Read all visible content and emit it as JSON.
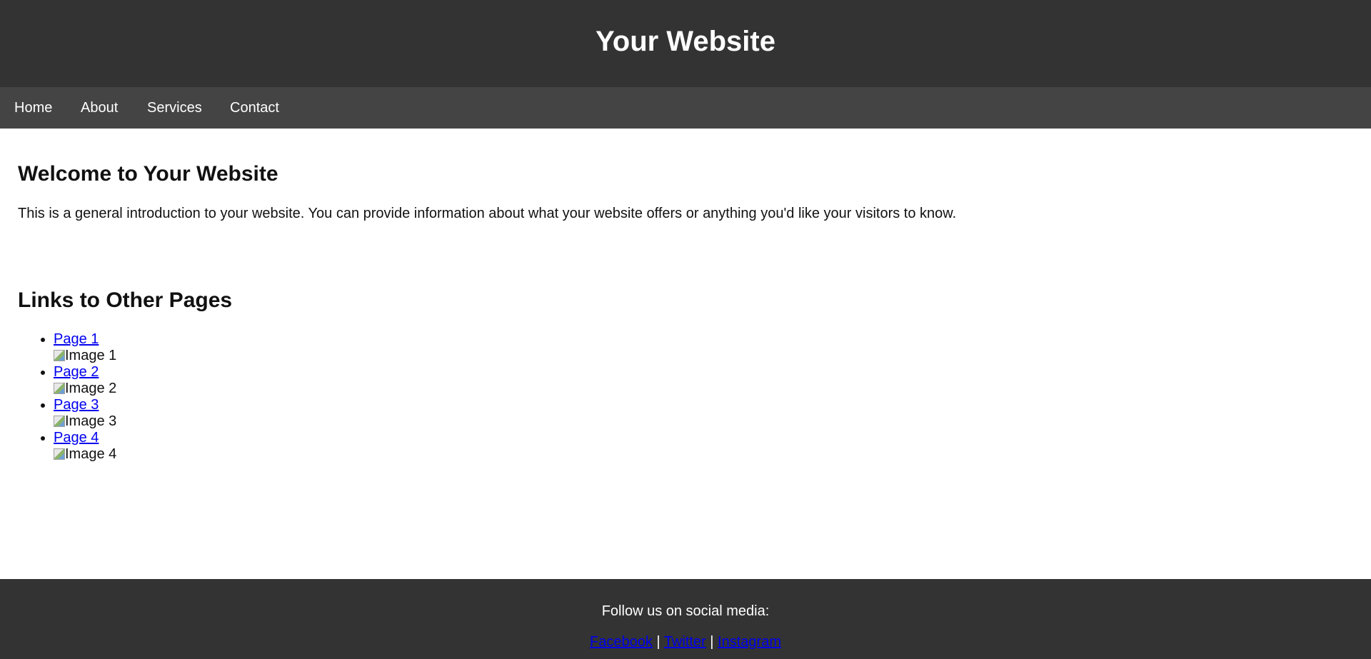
{
  "header": {
    "title": "Your Website"
  },
  "nav": {
    "items": [
      {
        "label": "Home"
      },
      {
        "label": "About"
      },
      {
        "label": "Services"
      },
      {
        "label": "Contact"
      }
    ]
  },
  "intro": {
    "heading": "Welcome to Your Website",
    "text": "This is a general introduction to your website. You can provide information about what your website offers or anything you'd like your visitors to know."
  },
  "links_section": {
    "heading": "Links to Other Pages",
    "items": [
      {
        "link": "Page 1",
        "image_alt": "Image 1"
      },
      {
        "link": "Page 2",
        "image_alt": "Image 2"
      },
      {
        "link": "Page 3",
        "image_alt": "Image 3"
      },
      {
        "link": "Page 4",
        "image_alt": "Image 4"
      }
    ]
  },
  "footer": {
    "text": "Follow us on social media:",
    "separator": "|",
    "social_links": [
      {
        "label": "Facebook"
      },
      {
        "label": "Twitter"
      },
      {
        "label": "Instagram"
      }
    ]
  },
  "colors": {
    "header_bg": "#333333",
    "nav_bg": "#444444",
    "footer_bg": "#333333",
    "link": "#0000ee"
  },
  "icons": {
    "broken_image": "broken-image-icon"
  }
}
